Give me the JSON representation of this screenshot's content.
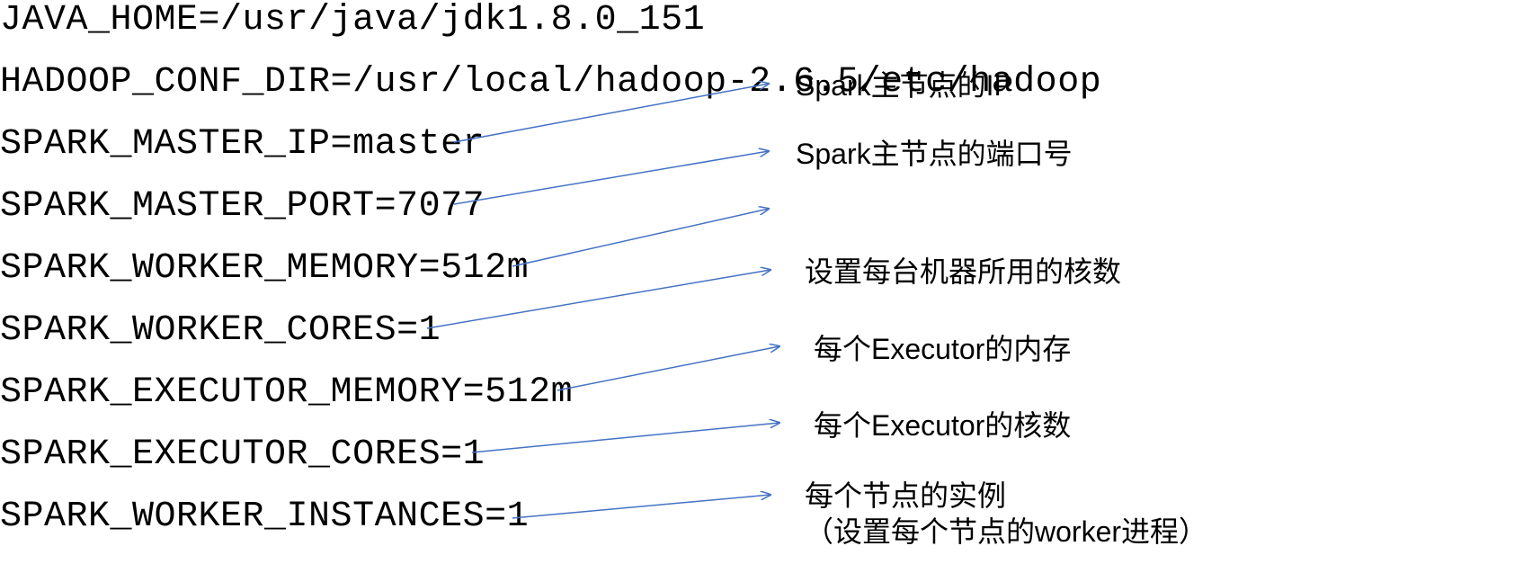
{
  "config_lines": [
    "JAVA_HOME=/usr/java/jdk1.8.0_151",
    "HADOOP_CONF_DIR=/usr/local/hadoop-2.6.5/etc/hadoop",
    "SPARK_MASTER_IP=master",
    "SPARK_MASTER_PORT=7077",
    "SPARK_WORKER_MEMORY=512m",
    "SPARK_WORKER_CORES=1",
    "SPARK_EXECUTOR_MEMORY=512m",
    "SPARK_EXECUTOR_CORES=1",
    "SPARK_WORKER_INSTANCES=1"
  ],
  "annotations": {
    "a0": "Spark主节点的IP",
    "a1": "Spark主节点的端口号",
    "a2": "",
    "a3": "设置每台机器所用的核数",
    "a4": "每个Executor的内存",
    "a5": "每个Executor的核数",
    "a6_line1": "每个节点的实例",
    "a6_line2": "（设置每个节点的worker进程）"
  },
  "arrow_color": "#4472C4"
}
